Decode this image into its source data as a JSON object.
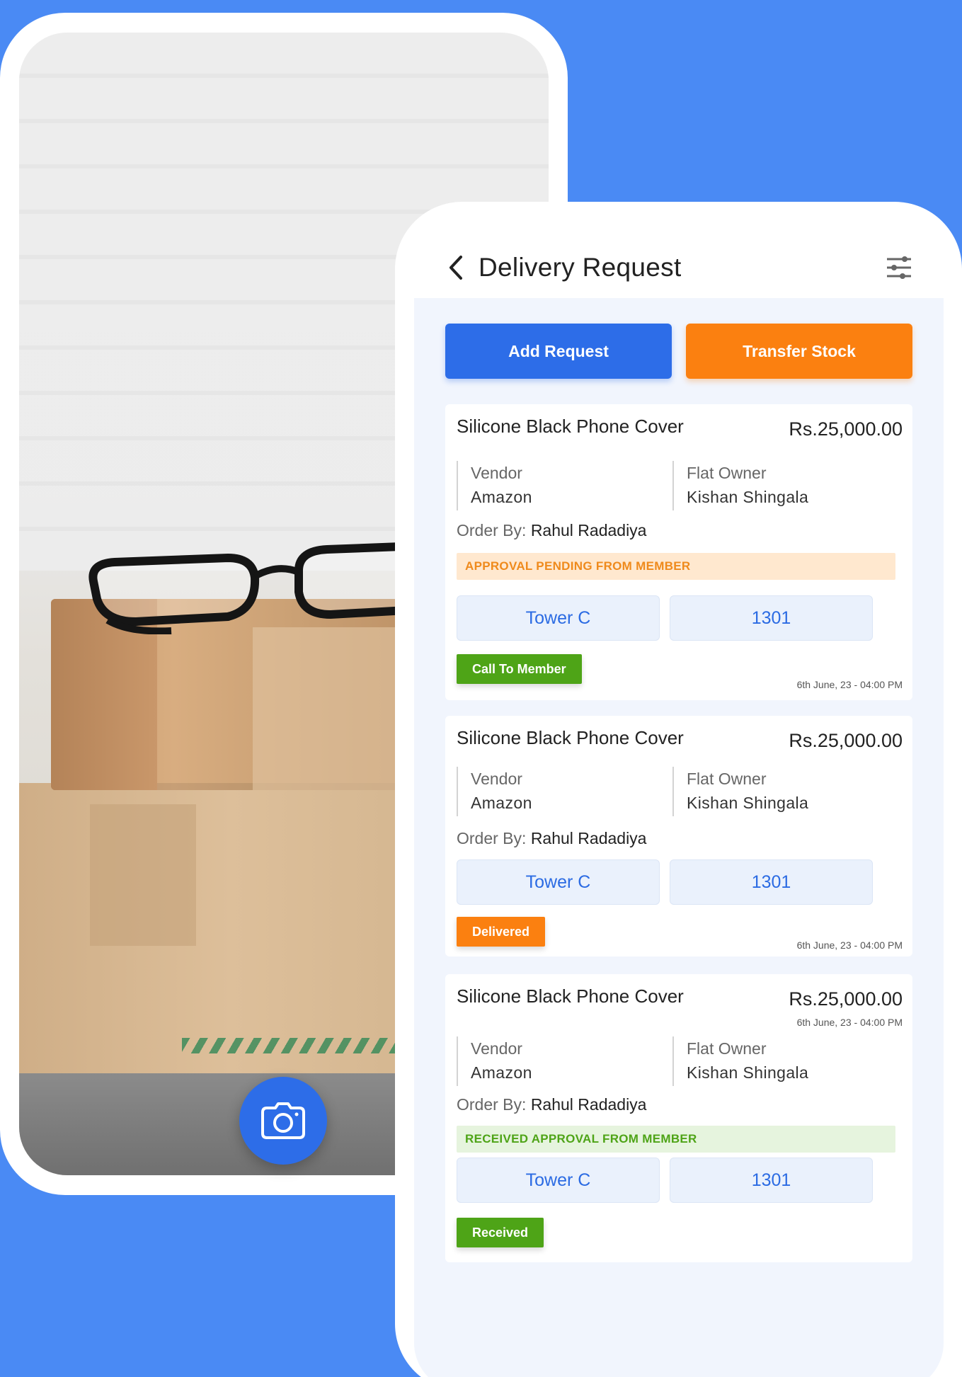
{
  "colors": {
    "background": "#4a8af4",
    "primary": "#2d6de8",
    "orange": "#fb8010",
    "green": "#4ea417",
    "tag_text": "#2b6be3"
  },
  "icons": {
    "camera": "camera-icon",
    "back": "chevron-left-icon",
    "filter": "sliders-icon"
  },
  "header": {
    "title": "Delivery Request"
  },
  "actions": {
    "add_request": "Add Request",
    "transfer_stock": "Transfer Stock"
  },
  "cards": [
    {
      "title": "Silicone Black Phone Cover",
      "price": "Rs.25,000.00",
      "vendor_label": "Vendor",
      "vendor": "Amazon",
      "owner_label": "Flat Owner",
      "owner": "Kishan Shingala",
      "order_by_label": "Order By:",
      "order_by": "Rahul Radadiya",
      "status": "APPROVAL PENDING FROM MEMBER",
      "tower": "Tower C",
      "flat": "1301",
      "action": "Call To Member",
      "time": "6th June, 23 - 04:00 PM"
    },
    {
      "title": "Silicone Black Phone Cover",
      "price": "Rs.25,000.00",
      "vendor_label": "Vendor",
      "vendor": "Amazon",
      "owner_label": "Flat Owner",
      "owner": "Kishan Shingala",
      "order_by_label": "Order By:",
      "order_by": "Rahul Radadiya",
      "tower": "Tower C",
      "flat": "1301",
      "action": "Delivered",
      "time": "6th June, 23 - 04:00 PM"
    },
    {
      "title": "Silicone Black Phone Cover",
      "price": "Rs.25,000.00",
      "time": "6th June, 23 - 04:00 PM",
      "vendor_label": "Vendor",
      "vendor": "Amazon",
      "owner_label": "Flat Owner",
      "owner": "Kishan Shingala",
      "order_by_label": "Order By:",
      "order_by": "Rahul Radadiya",
      "status": "RECEIVED APPROVAL FROM MEMBER",
      "tower": "Tower C",
      "flat": "1301",
      "action": "Received"
    }
  ]
}
